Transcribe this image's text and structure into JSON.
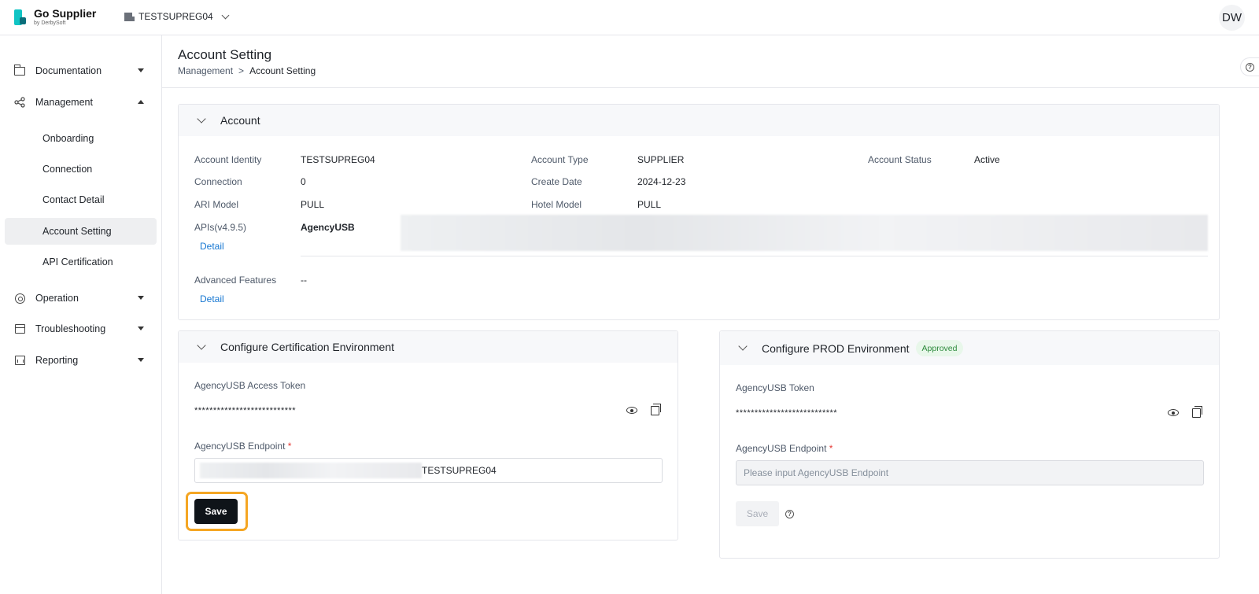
{
  "app": {
    "title": "Go Supplier",
    "subtitle": "by DerbySoft",
    "tenant": "TESTSUPREG04",
    "user_initials": "DW"
  },
  "sidebar": {
    "items": [
      {
        "label": "Documentation",
        "icon": "folder-icon"
      },
      {
        "label": "Management",
        "icon": "share-icon"
      },
      {
        "label": "Onboarding"
      },
      {
        "label": "Connection"
      },
      {
        "label": "Contact Detail"
      },
      {
        "label": "Account Setting"
      },
      {
        "label": "API Certification"
      },
      {
        "label": "Operation",
        "icon": "gear-icon"
      },
      {
        "label": "Troubleshooting",
        "icon": "troubleshooting-icon"
      },
      {
        "label": "Reporting",
        "icon": "reporting-icon"
      }
    ]
  },
  "page": {
    "title": "Account Setting",
    "breadcrumb": [
      "Management",
      ">",
      "Account Setting"
    ]
  },
  "account": {
    "title": "Account",
    "identity_label": "Account Identity",
    "identity": "TESTSUPREG04",
    "type_label": "Account Type",
    "type": "SUPPLIER",
    "status_label": "Account Status",
    "status": "Active",
    "connection_label": "Connection",
    "connection": "0",
    "create_date_label": "Create Date",
    "create_date": "2024-12-23",
    "ari_label": "ARI Model",
    "ari": "PULL",
    "hotel_model_label": "Hotel Model",
    "hotel_model": "PULL",
    "apis_label": "APIs(v4.9.5)",
    "apis": "AgencyUSB",
    "detail_link": "Detail",
    "advanced_label": "Advanced Features",
    "advanced": "--"
  },
  "cert_env": {
    "title": "Configure Certification Environment",
    "token_label": "AgencyUSB Access Token",
    "token_value": "***************************",
    "endpoint_label": "AgencyUSB Endpoint",
    "required_mark": "*",
    "endpoint_value": "TESTSUPREG04",
    "save_label": "Save"
  },
  "prod_env": {
    "title": "Configure PROD Environment",
    "badge": "Approved",
    "token_label": "AgencyUSB Token",
    "token_value": "***************************",
    "endpoint_label": "AgencyUSB Endpoint",
    "required_mark": "*",
    "endpoint_placeholder": "Please input AgencyUSB Endpoint",
    "save_label": "Save"
  },
  "colors": {
    "accent": "#1677d2",
    "brand": "#10c4c4",
    "highlight": "#f5a623",
    "approved": "#2e8b3d"
  }
}
